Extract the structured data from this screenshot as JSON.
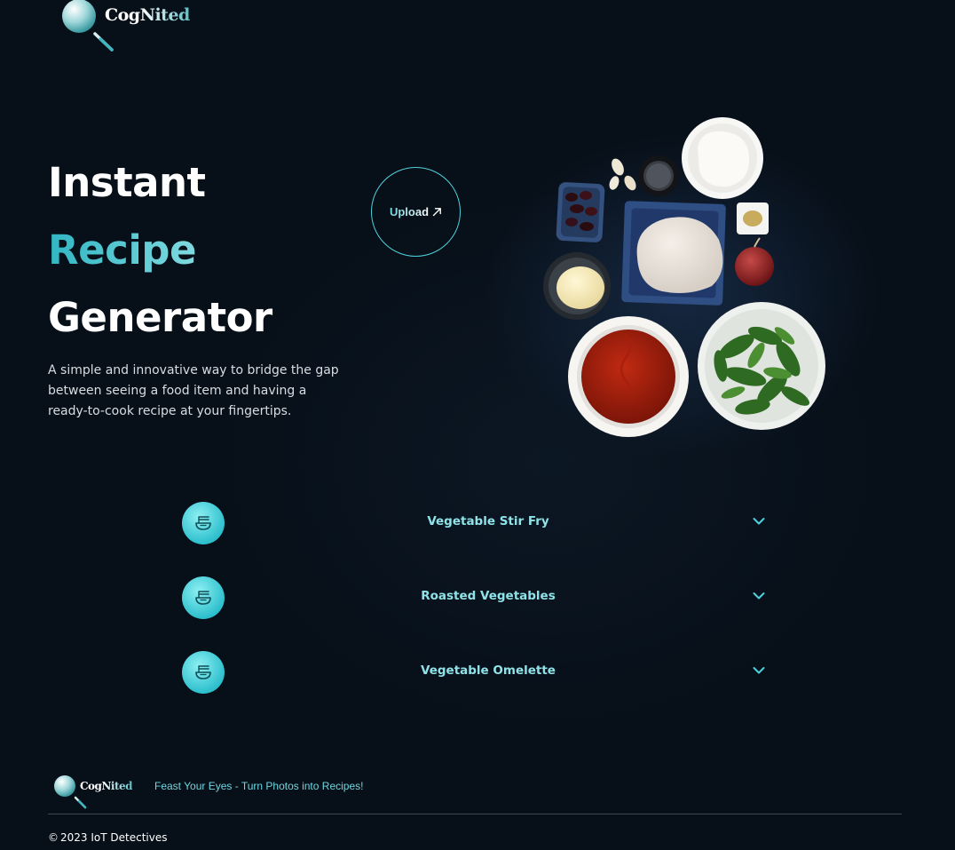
{
  "brand": {
    "logo_text": "CogNited",
    "logo_part1": "Cog",
    "logo_part2": "Nited"
  },
  "hero": {
    "title_line1": "Instant",
    "title_line2": "Recipe",
    "title_line3": "Generator",
    "description": "A simple and innovative way to bridge the gap between seeing a food item and having a ready-to-cook recipe at your fingertips."
  },
  "upload": {
    "label": "Upload",
    "icon": "arrow-up-right-icon"
  },
  "recipes": [
    {
      "name": "Vegetable Stir Fry",
      "icon": "noodle-bowl-icon"
    },
    {
      "name": "Roasted Vegetables",
      "icon": "noodle-bowl-icon"
    },
    {
      "name": "Vegetable Omelette",
      "icon": "noodle-bowl-icon"
    }
  ],
  "footer": {
    "tagline": "Feast Your Eyes - Turn Photos into Recipes!",
    "copyright": "2023 IoT Detectives",
    "copyright_symbol": "©"
  },
  "colors": {
    "background": "#070f18",
    "accent": "#4fd2dc",
    "accent_light": "#8fe3e8"
  }
}
